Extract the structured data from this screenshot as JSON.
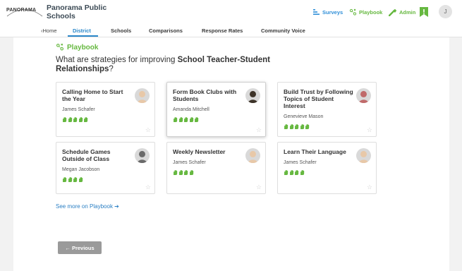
{
  "header": {
    "logo_text": "PANORAMA",
    "district_name": "Panorama Public Schools",
    "nav": {
      "surveys": "Surveys",
      "playbook": "Playbook",
      "admin": "Admin"
    },
    "user_initial": "J"
  },
  "subnav": {
    "home": "Home",
    "items": [
      "District",
      "Schools",
      "Comparisons",
      "Response Rates",
      "Community Voice"
    ],
    "active": "District"
  },
  "playbook": {
    "label": "Playbook",
    "question_prefix": "What are strategies for improving ",
    "question_topic": "School Teacher-Student Relationships",
    "question_suffix": "?",
    "see_more": "See more on Playbook ➔",
    "previous_button": "← Previous"
  },
  "cards": [
    {
      "title": "Calling Home to Start the Year",
      "author": "James Schafer",
      "hands": 5,
      "selected": false,
      "avatar_tone": "#e8c8a8"
    },
    {
      "title": "Form Book Clubs with Students",
      "author": "Amanda Mitchell",
      "hands": 5,
      "selected": true,
      "avatar_tone": "#3d3328"
    },
    {
      "title": "Build Trust by Following Topics of Student Interest",
      "author": "Genevieve Mason",
      "hands": 5,
      "selected": false,
      "avatar_tone": "#c06a6a"
    },
    {
      "title": "Schedule Games Outside of Class",
      "author": "Megan Jacobson",
      "hands": 4,
      "selected": false,
      "avatar_tone": "#6a6a6a"
    },
    {
      "title": "Weekly Newsletter",
      "author": "James Schafer",
      "hands": 4,
      "selected": false,
      "avatar_tone": "#e8c8a8"
    },
    {
      "title": "Learn Their Language",
      "author": "James Schafer",
      "hands": 4,
      "selected": false,
      "avatar_tone": "#e8c8a8"
    }
  ],
  "colors": {
    "accent_green": "#66b840",
    "accent_blue": "#2a87c9",
    "surveys_blue": "#2f8fd8"
  }
}
